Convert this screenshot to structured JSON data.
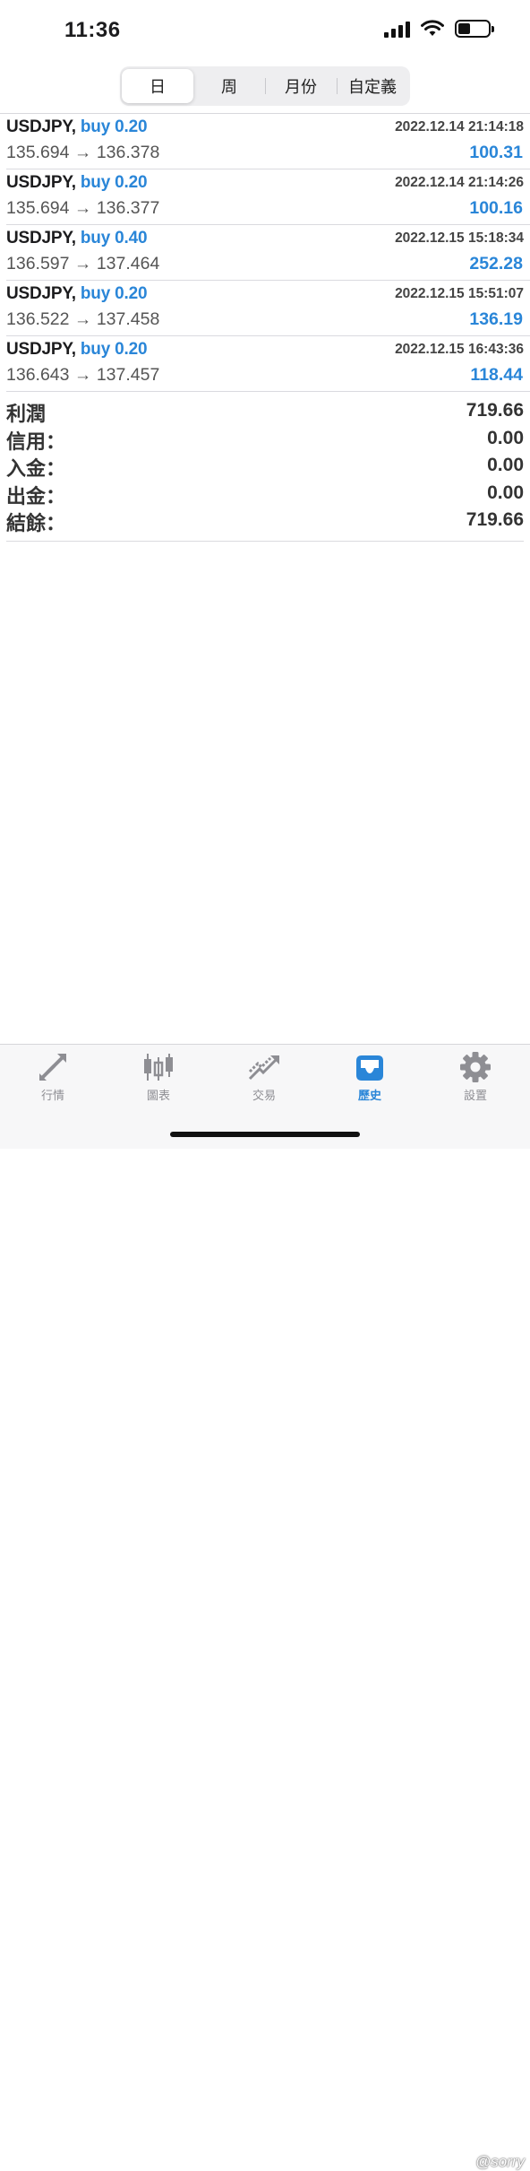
{
  "status_bar": {
    "time": "11:36",
    "battery_level": 0.4
  },
  "segments": [
    {
      "label": "日",
      "active": true
    },
    {
      "label": "周",
      "active": false
    },
    {
      "label": "月份",
      "active": false
    },
    {
      "label": "自定義",
      "active": false
    }
  ],
  "trades": [
    {
      "symbol": "USDJPY,",
      "side": "buy 0.20",
      "time": "2022.12.14 21:14:18",
      "prices": "135.694 → 136.378",
      "profit": "100.31"
    },
    {
      "symbol": "USDJPY,",
      "side": "buy 0.20",
      "time": "2022.12.14 21:14:26",
      "prices": "135.694 → 136.377",
      "profit": "100.16"
    },
    {
      "symbol": "USDJPY,",
      "side": "buy 0.40",
      "time": "2022.12.15 15:18:34",
      "prices": "136.597 → 137.464",
      "profit": "252.28"
    },
    {
      "symbol": "USDJPY,",
      "side": "buy 0.20",
      "time": "2022.12.15 15:51:07",
      "prices": "136.522 → 137.458",
      "profit": "136.19"
    },
    {
      "symbol": "USDJPY,",
      "side": "buy 0.20",
      "time": "2022.12.15 16:43:36",
      "prices": "136.643 → 137.457",
      "profit": "118.44"
    }
  ],
  "summary": [
    {
      "label": "利潤",
      "value": "719.66"
    },
    {
      "label": "信用：",
      "value": "0.00"
    },
    {
      "label": "入金：",
      "value": "0.00"
    },
    {
      "label": "出金：",
      "value": "0.00"
    },
    {
      "label": "結餘：",
      "value": "719.66"
    }
  ],
  "tabs": [
    {
      "label": "行情",
      "icon": "quotes-arrows-icon",
      "active": false
    },
    {
      "label": "圖表",
      "icon": "candlestick-chart-icon",
      "active": false
    },
    {
      "label": "交易",
      "icon": "trade-trend-icon",
      "active": false
    },
    {
      "label": "歷史",
      "icon": "history-inbox-icon",
      "active": true
    },
    {
      "label": "設置",
      "icon": "gear-icon",
      "active": false
    }
  ],
  "watermark": "@sorry",
  "colors": {
    "accent": "#2a86d8",
    "text": "#1c1c1e",
    "muted": "#8e8e93"
  }
}
